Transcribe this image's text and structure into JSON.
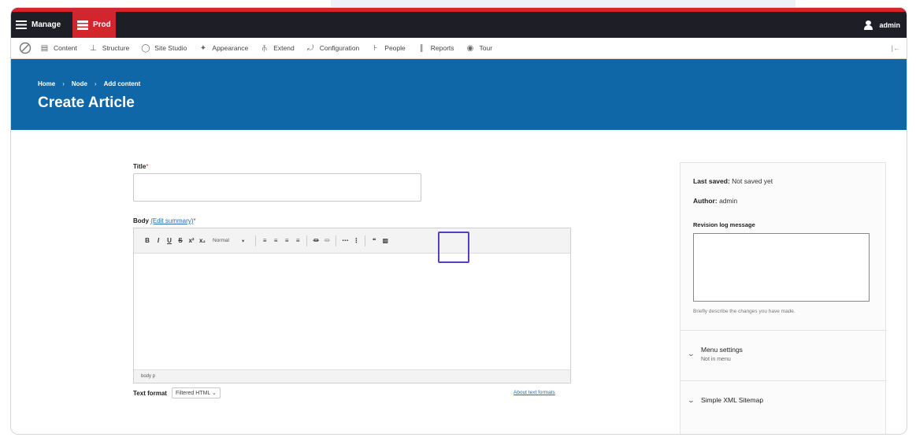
{
  "toolbar": {
    "manage_label": "Manage",
    "env_label": "Prod",
    "user_label": "admin"
  },
  "menu": {
    "items": [
      {
        "label": "Content",
        "icon": "content-icon"
      },
      {
        "label": "Structure",
        "icon": "structure-icon"
      },
      {
        "label": "Site Studio",
        "icon": "site-studio-icon"
      },
      {
        "label": "Appearance",
        "icon": "appearance-icon"
      },
      {
        "label": "Extend",
        "icon": "extend-icon"
      },
      {
        "label": "Configuration",
        "icon": "configuration-icon"
      },
      {
        "label": "People",
        "icon": "people-icon"
      },
      {
        "label": "Reports",
        "icon": "reports-icon"
      },
      {
        "label": "Tour",
        "icon": "tour-icon"
      }
    ],
    "collapse_label": "|←"
  },
  "header": {
    "breadcrumb": [
      "Home",
      "Node",
      "Add content"
    ],
    "title": "Create Article"
  },
  "form": {
    "title_label": "Title",
    "required_mark": "*",
    "body_label": "Body",
    "edit_summary_label": "(Edit summary)",
    "editor": {
      "format_value": "Normal",
      "status_path": "body  p"
    },
    "text_format_label": "Text format",
    "text_format_value": "Filtered HTML",
    "about_formats_label": "About text formats"
  },
  "sidebar": {
    "last_saved_label": "Last saved:",
    "last_saved_value": "Not saved yet",
    "author_label": "Author:",
    "author_value": "admin",
    "revision_label": "Revision log message",
    "revision_help": "Briefly describe the changes you have made.",
    "menu_settings_title": "Menu settings",
    "menu_settings_sub": "Not in menu",
    "sitemap_title": "Simple XML Sitemap"
  },
  "colors": {
    "accent_red": "#d3252c",
    "header_blue": "#1067a8",
    "admin_bar": "#1e1f26",
    "highlight": "#5b3cc4"
  }
}
